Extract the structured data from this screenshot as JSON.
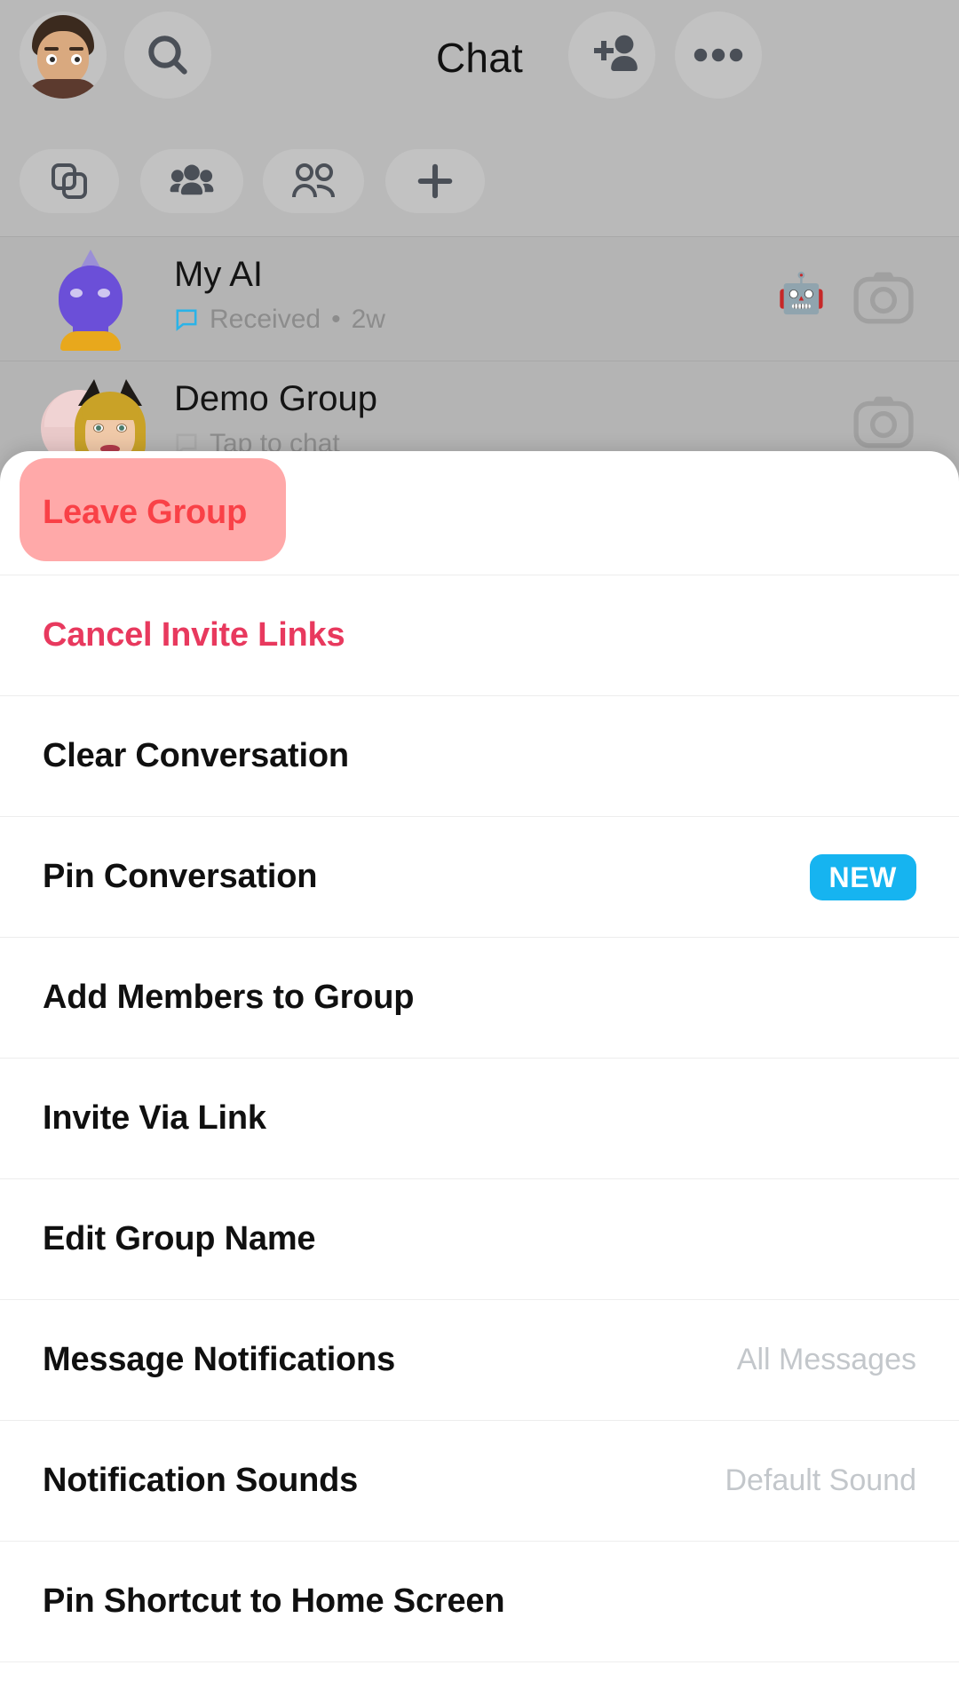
{
  "app": {
    "header": {
      "title": "Chat",
      "avatar_icon": "bitmoji-avatar",
      "search_icon": "search-icon",
      "add_friend_icon": "add-friend-icon",
      "more_icon": "more-options-icon"
    },
    "filters": [
      {
        "name": "filter-snaps",
        "icon": "snaps-icon"
      },
      {
        "name": "filter-groups",
        "icon": "groups-icon"
      },
      {
        "name": "filter-friends",
        "icon": "friends-icon"
      },
      {
        "name": "filter-add",
        "icon": "plus-icon"
      }
    ],
    "chats": [
      {
        "name": "My AI",
        "status": "Received",
        "separator": "•",
        "time": "2w",
        "badge_icon": "robot-emoji",
        "camera_icon": "camera-icon",
        "status_icon": "chat-received-icon"
      },
      {
        "name": "Demo Group",
        "status": "Tap to chat",
        "separator": "",
        "time": "",
        "badge_icon": "",
        "camera_icon": "camera-icon",
        "status_icon": "chat-bubble-icon"
      }
    ]
  },
  "sheet": {
    "items": [
      {
        "label": "Leave Group",
        "style": "danger",
        "value": "",
        "badge": "",
        "highlighted": true
      },
      {
        "label": "Cancel Invite Links",
        "style": "pinkred",
        "value": "",
        "badge": "",
        "highlighted": false
      },
      {
        "label": "Clear Conversation",
        "style": "normal",
        "value": "",
        "badge": "",
        "highlighted": false
      },
      {
        "label": "Pin Conversation",
        "style": "normal",
        "value": "",
        "badge": "NEW",
        "highlighted": false
      },
      {
        "label": "Add Members to Group",
        "style": "normal",
        "value": "",
        "badge": "",
        "highlighted": false
      },
      {
        "label": "Invite Via Link",
        "style": "normal",
        "value": "",
        "badge": "",
        "highlighted": false
      },
      {
        "label": "Edit Group Name",
        "style": "normal",
        "value": "",
        "badge": "",
        "highlighted": false
      },
      {
        "label": "Message Notifications",
        "style": "normal",
        "value": "All Messages",
        "badge": "",
        "highlighted": false
      },
      {
        "label": "Notification Sounds",
        "style": "normal",
        "value": "Default Sound",
        "badge": "",
        "highlighted": false
      },
      {
        "label": "Pin Shortcut to Home Screen",
        "style": "normal",
        "value": "",
        "badge": "",
        "highlighted": false
      }
    ]
  },
  "colors": {
    "danger_red": "#f4424e",
    "pink_red": "#e8395e",
    "badge_blue": "#16b4f0",
    "value_gray": "#c3c7cb",
    "highlight_overlay": "rgba(255,64,64,0.45)"
  }
}
